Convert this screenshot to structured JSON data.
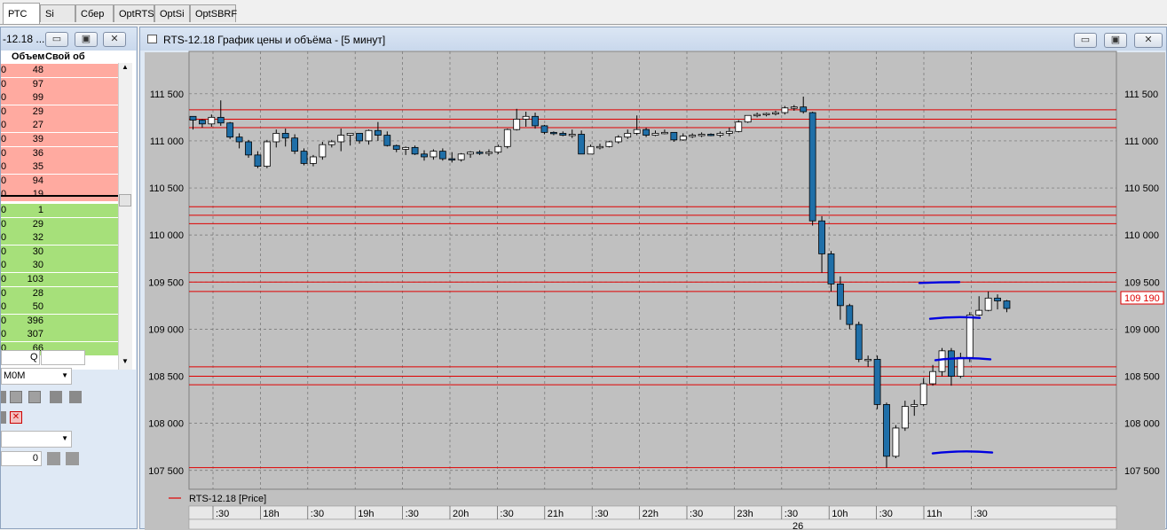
{
  "tabs": [
    {
      "label": "РТС",
      "active": true
    },
    {
      "label": "Si"
    },
    {
      "label": "Сбер"
    },
    {
      "label": "OptRTS"
    },
    {
      "label": "OptSi"
    },
    {
      "label": "OptSBRF"
    }
  ],
  "left_window": {
    "title": "-12.18 ...",
    "buttons": {
      "minimize": "▭",
      "restore": "▣",
      "close": "✕"
    },
    "headers": {
      "volume": "Объем",
      "own": "Свой об"
    },
    "asks": [
      "48",
      "97",
      "99",
      "29",
      "27",
      "39",
      "36",
      "35",
      "94",
      "19"
    ],
    "bids": [
      "1",
      "29",
      "32",
      "30",
      "30",
      "103",
      "28",
      "50",
      "396",
      "307",
      "66"
    ],
    "row_edge": "0",
    "q_label": "Q",
    "select_value": "М0М",
    "qty_value": "0"
  },
  "chart_window": {
    "title": "RTS-12.18 График цены и объёма - [5 минут]",
    "legend": "RTS-12.18 [Price]",
    "last_price": "109 190",
    "date_label": "26",
    "colors": {
      "up": "#ffffff",
      "down": "#1f6fa8",
      "level": "#e00000",
      "annot": "#0000e0",
      "plot_bg": "#c0c0c0"
    }
  },
  "chart_data": {
    "type": "candlestick",
    "ylim": [
      107300,
      111950
    ],
    "y_ticks": [
      {
        "v": 111500,
        "label": "111 500"
      },
      {
        "v": 111000,
        "label": "111 000"
      },
      {
        "v": 110500,
        "label": "110 500"
      },
      {
        "v": 110000,
        "label": "110 000"
      },
      {
        "v": 109500,
        "label": "109 500"
      },
      {
        "v": 109000,
        "label": "109 000"
      },
      {
        "v": 108500,
        "label": "108 500"
      },
      {
        "v": 108000,
        "label": "108 000"
      },
      {
        "v": 107500,
        "label": "107 500"
      }
    ],
    "x_ticks": [
      ":30",
      "18h",
      ":30",
      "19h",
      ":30",
      "20h",
      ":30",
      "21h",
      ":30",
      "22h",
      ":30",
      "23h",
      ":30",
      "10h",
      ":30",
      "11h",
      ":30"
    ],
    "levels": [
      111330,
      111230,
      111140,
      110300,
      110210,
      110120,
      109600,
      109500,
      109400,
      108600,
      108500,
      108410,
      107530
    ],
    "annotations": [
      109500,
      109120,
      108680,
      107690
    ],
    "candles": [
      [
        111260,
        111260,
        111120,
        111220
      ],
      [
        111220,
        111230,
        111140,
        111180
      ],
      [
        111180,
        111280,
        111150,
        111250
      ],
      [
        111250,
        111430,
        111160,
        111190
      ],
      [
        111190,
        111200,
        111020,
        111040
      ],
      [
        111040,
        111080,
        110920,
        110990
      ],
      [
        110990,
        111010,
        110820,
        110850
      ],
      [
        110850,
        110890,
        110710,
        110730
      ],
      [
        110730,
        111010,
        110710,
        110990
      ],
      [
        110990,
        111120,
        110930,
        111080
      ],
      [
        111080,
        111130,
        110940,
        111030
      ],
      [
        111030,
        111070,
        110860,
        110890
      ],
      [
        110890,
        110920,
        110740,
        110760
      ],
      [
        110760,
        110850,
        110730,
        110830
      ],
      [
        110830,
        110990,
        110800,
        110960
      ],
      [
        110960,
        111010,
        110930,
        110990
      ],
      [
        110990,
        111130,
        110890,
        111060
      ],
      [
        111060,
        111080,
        110950,
        111080
      ],
      [
        111080,
        111080,
        110970,
        111000
      ],
      [
        111000,
        111120,
        110960,
        111110
      ],
      [
        111110,
        111200,
        111000,
        111060
      ],
      [
        111060,
        111100,
        110940,
        110950
      ],
      [
        110950,
        110960,
        110880,
        110910
      ],
      [
        110910,
        110940,
        110850,
        110930
      ],
      [
        110930,
        110950,
        110850,
        110860
      ],
      [
        110860,
        110900,
        110790,
        110830
      ],
      [
        110830,
        110910,
        110800,
        110890
      ],
      [
        110890,
        110920,
        110790,
        110810
      ],
      [
        110810,
        110880,
        110770,
        110800
      ],
      [
        110800,
        110870,
        110780,
        110860
      ],
      [
        110860,
        110890,
        110820,
        110880
      ],
      [
        110880,
        110900,
        110850,
        110870
      ],
      [
        110870,
        110910,
        110840,
        110880
      ],
      [
        110880,
        110960,
        110860,
        110940
      ],
      [
        110940,
        111130,
        110920,
        111120
      ],
      [
        111120,
        111340,
        111110,
        111230
      ],
      [
        111230,
        111310,
        111150,
        111260
      ],
      [
        111260,
        111300,
        111130,
        111160
      ],
      [
        111160,
        111170,
        111070,
        111090
      ],
      [
        111090,
        111100,
        111060,
        111080
      ],
      [
        111080,
        111100,
        111050,
        111060
      ],
      [
        111060,
        111120,
        111030,
        111070
      ],
      [
        111070,
        111110,
        110870,
        110860
      ],
      [
        110860,
        110960,
        110860,
        110940
      ],
      [
        110940,
        110970,
        110910,
        110940
      ],
      [
        110940,
        111000,
        110930,
        110990
      ],
      [
        110990,
        111060,
        110970,
        111040
      ],
      [
        111040,
        111120,
        111020,
        111080
      ],
      [
        111080,
        111270,
        111060,
        111120
      ],
      [
        111120,
        111140,
        111040,
        111060
      ],
      [
        111060,
        111110,
        111050,
        111080
      ],
      [
        111080,
        111120,
        111070,
        111090
      ],
      [
        111090,
        111090,
        110990,
        111010
      ],
      [
        111010,
        111080,
        111000,
        111050
      ],
      [
        111050,
        111080,
        111030,
        111060
      ],
      [
        111060,
        111090,
        111040,
        111070
      ],
      [
        111070,
        111080,
        111050,
        111060
      ],
      [
        111060,
        111100,
        111040,
        111080
      ],
      [
        111080,
        111140,
        111050,
        111100
      ],
      [
        111100,
        111220,
        111090,
        111200
      ],
      [
        111200,
        111250,
        111190,
        111270
      ],
      [
        111270,
        111300,
        111250,
        111280
      ],
      [
        111280,
        111300,
        111260,
        111290
      ],
      [
        111290,
        111320,
        111270,
        111300
      ],
      [
        111300,
        111370,
        111280,
        111350
      ],
      [
        111350,
        111380,
        111320,
        111360
      ],
      [
        111360,
        111470,
        111290,
        111310
      ],
      [
        111300,
        111310,
        110100,
        110150
      ],
      [
        110150,
        110200,
        109600,
        109800
      ],
      [
        109800,
        109830,
        109400,
        109480
      ],
      [
        109480,
        109560,
        109100,
        109250
      ],
      [
        109250,
        109270,
        109000,
        109050
      ],
      [
        109050,
        109080,
        108650,
        108680
      ],
      [
        108680,
        108720,
        108600,
        108680
      ],
      [
        108680,
        108720,
        108150,
        108200
      ],
      [
        108200,
        108220,
        107530,
        107650
      ],
      [
        107650,
        107980,
        107630,
        107950
      ],
      [
        107950,
        108240,
        107920,
        108180
      ],
      [
        108180,
        108250,
        108080,
        108200
      ],
      [
        108200,
        108480,
        108180,
        108420
      ],
      [
        108420,
        108620,
        108400,
        108550
      ],
      [
        108550,
        108800,
        108500,
        108770
      ],
      [
        108770,
        108800,
        108400,
        108500
      ],
      [
        108500,
        108750,
        108480,
        108700
      ],
      [
        108700,
        109180,
        108650,
        109150
      ],
      [
        109150,
        109350,
        109140,
        109200
      ],
      [
        109200,
        109400,
        109190,
        109330
      ],
      [
        109330,
        109370,
        109210,
        109300
      ],
      [
        109300,
        109310,
        109180,
        109220
      ]
    ]
  }
}
